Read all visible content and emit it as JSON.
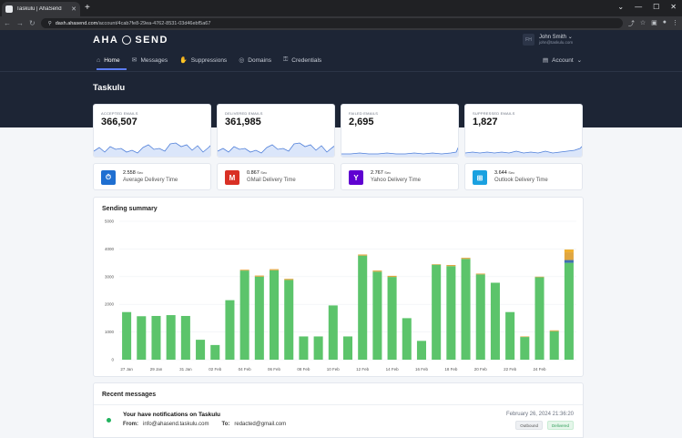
{
  "browser": {
    "tab_title": "Taskulu | AhaSend",
    "url_domain": "dash.ahasend.com",
    "url_path": "/account/4cab7fe8-29ea-4762-8531-03d46ebf5a67"
  },
  "header": {
    "logo_text_left": "AHA",
    "logo_text_right": "SEND",
    "user": {
      "initials": "FH",
      "name": "John Smith",
      "email": "john@taskulu.com"
    },
    "nav": [
      {
        "label": "Home",
        "icon": "home-icon"
      },
      {
        "label": "Messages",
        "icon": "mail-icon"
      },
      {
        "label": "Suppressions",
        "icon": "hand-icon"
      },
      {
        "label": "Domains",
        "icon": "globe-icon"
      },
      {
        "label": "Credentials",
        "icon": "key-icon"
      }
    ],
    "account_label": "Account",
    "page_title": "Taskulu"
  },
  "stats": [
    {
      "label": "ACCEPTED EMAILS",
      "value": "366,507"
    },
    {
      "label": "DELIVERED EMAILS",
      "value": "361,985"
    },
    {
      "label": "FAILED EMAILS",
      "value": "2,695"
    },
    {
      "label": "SUPPRESSED EMAILS",
      "value": "1,827"
    }
  ],
  "delivery": [
    {
      "value": "2.558",
      "unit": "Sec",
      "label": "Average Delivery Time",
      "icon": "clock-icon",
      "icon_glyph": "⏱",
      "color": "#1f6fd1"
    },
    {
      "value": "0.867",
      "unit": "Sec",
      "label": "GMail Delivery Time",
      "icon": "gmail-icon",
      "icon_glyph": "M",
      "color": "#d93025"
    },
    {
      "value": "2.767",
      "unit": "Sec",
      "label": "Yahoo Delivery Time",
      "icon": "yahoo-icon",
      "icon_glyph": "Y",
      "color": "#5f01d1"
    },
    {
      "value": "3.644",
      "unit": "Sec",
      "label": "Outlook Delivery Time",
      "icon": "outlook-icon",
      "icon_glyph": "⊞",
      "color": "#1aa1e0"
    }
  ],
  "chart_title": "Sending summary",
  "chart_data": {
    "type": "bar",
    "stacked": true,
    "ylim": [
      0,
      5000
    ],
    "yticks": [
      0,
      1000,
      2000,
      3000,
      4000,
      5000
    ],
    "x_tick_labels": [
      "27 Jan",
      "29 Jan",
      "31 Jan",
      "02 Feb",
      "04 Feb",
      "06 Feb",
      "08 Feb",
      "10 Feb",
      "12 Feb",
      "14 Feb",
      "16 Feb",
      "18 Feb",
      "20 Feb",
      "22 Feb",
      "24 Feb"
    ],
    "grid": true,
    "colors": [
      "#5cc46b",
      "#3e6fb0",
      "#e0a640",
      "#f0b030"
    ],
    "series": [
      {
        "values": [
          1720,
          1570,
          1580,
          1610,
          1580,
          720,
          530,
          2150,
          3220,
          3000,
          3230,
          2880,
          840,
          840,
          1960,
          840,
          3760,
          3180,
          2990,
          1500,
          680,
          3430,
          3380,
          3640,
          3080,
          2780,
          1720,
          820,
          2980,
          1030,
          3500
        ]
      },
      {
        "values": [
          0,
          0,
          0,
          0,
          0,
          0,
          0,
          0,
          0,
          0,
          0,
          0,
          0,
          0,
          0,
          0,
          0,
          0,
          0,
          0,
          0,
          0,
          0,
          0,
          0,
          0,
          0,
          0,
          0,
          0,
          100
        ]
      },
      {
        "values": [
          0,
          0,
          0,
          0,
          0,
          0,
          0,
          0,
          30,
          40,
          40,
          40,
          0,
          0,
          0,
          0,
          40,
          40,
          40,
          0,
          0,
          20,
          40,
          40,
          30,
          0,
          0,
          20,
          20,
          30,
          280
        ]
      },
      {
        "values": [
          0,
          0,
          0,
          0,
          0,
          0,
          0,
          0,
          0,
          0,
          0,
          0,
          0,
          0,
          0,
          0,
          0,
          0,
          0,
          0,
          0,
          0,
          0,
          0,
          0,
          0,
          0,
          0,
          0,
          0,
          100
        ]
      }
    ]
  },
  "recent": {
    "title": "Recent messages",
    "message": {
      "subject": "Your have notifications on Taskulu",
      "from_label": "From:",
      "from": "info@ahasend.taskulu.com",
      "to_label": "To:",
      "to": "redacted@gmail.com",
      "date": "February 26, 2024 21:36:20",
      "badge_direction": "Outbound",
      "badge_status": "Delivered"
    }
  }
}
